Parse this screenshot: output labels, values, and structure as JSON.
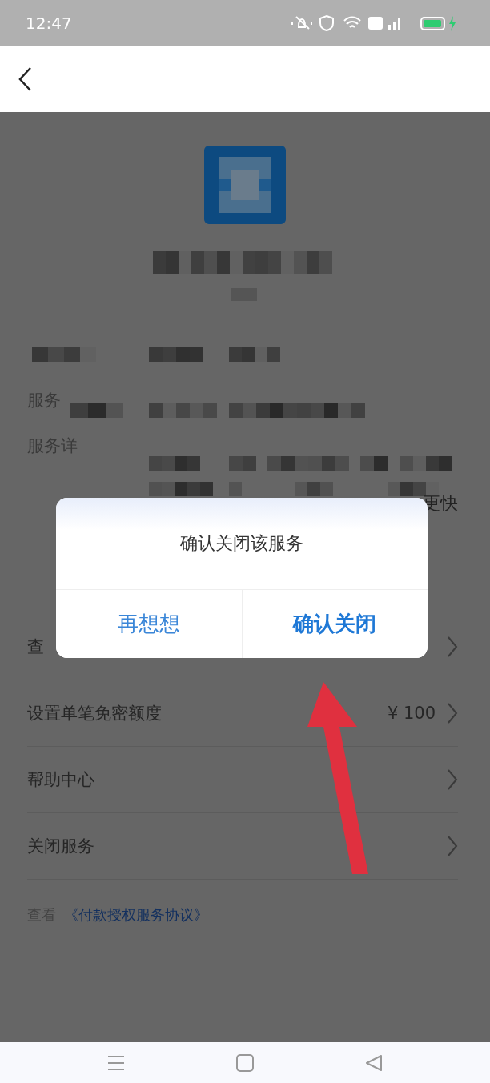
{
  "status_bar": {
    "time": "12:47"
  },
  "detail_labels": [
    "服务",
    "服务详"
  ],
  "behind_text": "更快",
  "menu_rows": [
    {
      "label": "查"
    },
    {
      "label": "设置单笔免密额度",
      "value": "¥ 100"
    },
    {
      "label": "帮助中心"
    },
    {
      "label": "关闭服务"
    }
  ],
  "agreement": {
    "prefix": "查看",
    "link": "《付款授权服务协议》"
  },
  "dialog": {
    "message": "确认关闭该服务",
    "buttons": [
      {
        "label": "再想想",
        "kind": "cancel"
      },
      {
        "label": "确认关闭",
        "kind": "confirm"
      }
    ]
  }
}
